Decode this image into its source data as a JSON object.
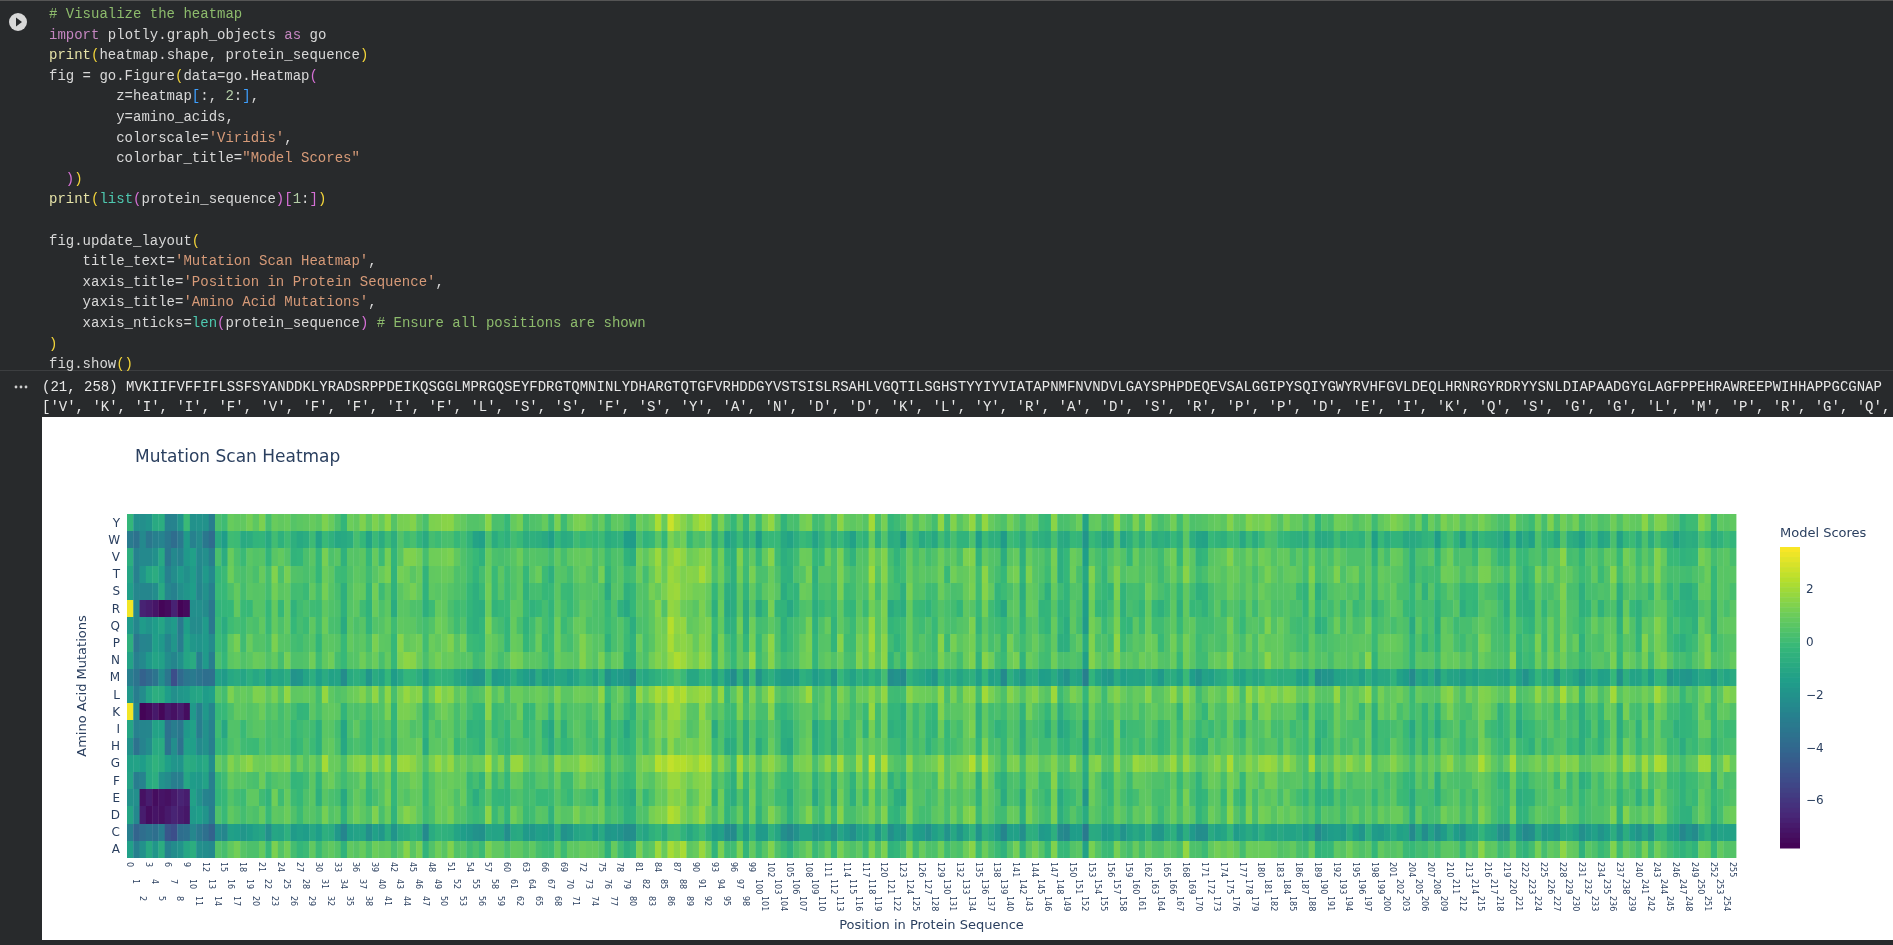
{
  "code_cell": {
    "lines": [
      {
        "tokens": [
          {
            "kind": "comment",
            "text": "# Visualize the heatmap"
          }
        ]
      },
      {
        "tokens": [
          {
            "kind": "keyword",
            "text": "import"
          },
          {
            "kind": "plain",
            "text": " plotly.graph_objects "
          },
          {
            "kind": "keyword",
            "text": "as"
          },
          {
            "kind": "plain",
            "text": " go"
          }
        ]
      },
      {
        "tokens": [
          {
            "kind": "func",
            "text": "print"
          },
          {
            "kind": "b1",
            "text": "("
          },
          {
            "kind": "plain",
            "text": "heatmap.shape, protein_sequence"
          },
          {
            "kind": "b1",
            "text": ")"
          }
        ]
      },
      {
        "tokens": [
          {
            "kind": "plain",
            "text": "fig = go.Figure"
          },
          {
            "kind": "b1",
            "text": "("
          },
          {
            "kind": "plain",
            "text": "data=go.Heatmap"
          },
          {
            "kind": "b2",
            "text": "("
          }
        ]
      },
      {
        "tokens": [
          {
            "kind": "plain",
            "text": "        z=heatmap"
          },
          {
            "kind": "b3",
            "text": "["
          },
          {
            "kind": "plain",
            "text": ":, "
          },
          {
            "kind": "number",
            "text": "2"
          },
          {
            "kind": "plain",
            "text": ":"
          },
          {
            "kind": "b3",
            "text": "]"
          },
          {
            "kind": "plain",
            "text": ","
          }
        ]
      },
      {
        "tokens": [
          {
            "kind": "plain",
            "text": "        y=amino_acids,"
          }
        ]
      },
      {
        "tokens": [
          {
            "kind": "plain",
            "text": "        colorscale="
          },
          {
            "kind": "string",
            "text": "'Viridis'"
          },
          {
            "kind": "plain",
            "text": ","
          }
        ]
      },
      {
        "tokens": [
          {
            "kind": "plain",
            "text": "        colorbar_title="
          },
          {
            "kind": "string",
            "text": "\"Model Scores\""
          }
        ]
      },
      {
        "tokens": [
          {
            "kind": "b2",
            "text": "  )"
          },
          {
            "kind": "b1",
            "text": ")"
          }
        ]
      },
      {
        "tokens": [
          {
            "kind": "func",
            "text": "print"
          },
          {
            "kind": "b1",
            "text": "("
          },
          {
            "kind": "builtin",
            "text": "list"
          },
          {
            "kind": "b2",
            "text": "("
          },
          {
            "kind": "plain",
            "text": "protein_sequence"
          },
          {
            "kind": "b2",
            "text": ")"
          },
          {
            "kind": "b2",
            "text": "["
          },
          {
            "kind": "number",
            "text": "1"
          },
          {
            "kind": "plain",
            "text": ":"
          },
          {
            "kind": "b2",
            "text": "]"
          },
          {
            "kind": "b1",
            "text": ")"
          }
        ]
      },
      {
        "gap_before": true,
        "tokens": [
          {
            "kind": "plain",
            "text": "fig.update_layout"
          },
          {
            "kind": "b1",
            "text": "("
          }
        ]
      },
      {
        "tokens": [
          {
            "kind": "plain",
            "text": "    title_text="
          },
          {
            "kind": "string",
            "text": "'Mutation Scan Heatmap'"
          },
          {
            "kind": "plain",
            "text": ","
          }
        ]
      },
      {
        "tokens": [
          {
            "kind": "plain",
            "text": "    xaxis_title="
          },
          {
            "kind": "string",
            "text": "'Position in Protein Sequence'"
          },
          {
            "kind": "plain",
            "text": ","
          }
        ]
      },
      {
        "tokens": [
          {
            "kind": "plain",
            "text": "    yaxis_title="
          },
          {
            "kind": "string",
            "text": "'Amino Acid Mutations'"
          },
          {
            "kind": "plain",
            "text": ","
          }
        ]
      },
      {
        "tokens": [
          {
            "kind": "plain",
            "text": "    xaxis_nticks="
          },
          {
            "kind": "builtin",
            "text": "len"
          },
          {
            "kind": "b2",
            "text": "("
          },
          {
            "kind": "plain",
            "text": "protein_sequence"
          },
          {
            "kind": "b2",
            "text": ")"
          },
          {
            "kind": "comment",
            "text": " # Ensure all positions are shown"
          }
        ]
      },
      {
        "tokens": [
          {
            "kind": "b1",
            "text": ")"
          }
        ]
      },
      {
        "tokens": [
          {
            "kind": "plain",
            "text": "fig.show"
          },
          {
            "kind": "b1",
            "text": "()"
          }
        ]
      }
    ]
  },
  "output": {
    "lines": [
      "(21, 258) MVKIIFVFFIFLSSFSYANDDKLYRADSRPPDEIKQSGGLMPRGQSEYFDRGTQMNINLYDHARGTQTGFVRHDDGYVSTSISLRSAHLVGQTILSGHSTYYIYVIATAPNMFNVNDVLGAYSPHPDEQEVSALGGIPYSQIYGWYRVHFGVLDEQLHRNRGYRDRYYSNLDIAPAADGYGLAGFPPEHRAWREEPWIHHAPPGCGNAP",
      "['V', 'K', 'I', 'I', 'F', 'V', 'F', 'F', 'I', 'F', 'L', 'S', 'S', 'F', 'S', 'Y', 'A', 'N', 'D', 'D', 'K', 'L', 'Y', 'R', 'A', 'D', 'S', 'R', 'P', 'P', 'D', 'E', 'I', 'K', 'Q', 'S', 'G', 'G', 'L', 'M', 'P', 'R', 'G', 'Q',"
    ]
  },
  "plot": {
    "title": "Mutation Scan Heatmap",
    "yaxis_title": "Amino Acid Mutations",
    "xaxis_title": "Position in Protein Sequence",
    "y_labels": [
      "Y",
      "W",
      "V",
      "T",
      "S",
      "R",
      "Q",
      "P",
      "N",
      "M",
      "L",
      "K",
      "I",
      "H",
      "G",
      "F",
      "E",
      "D",
      "C",
      "A"
    ],
    "x_ticks": [
      "0",
      "1",
      "2",
      "3",
      "4",
      "5",
      "6",
      "7",
      "8",
      "9",
      "10",
      "11",
      "12",
      "13",
      "14",
      "15",
      "16",
      "17",
      "18",
      "19",
      "20",
      "21",
      "22",
      "23",
      "24",
      "25",
      "26",
      "27",
      "28",
      "29",
      "30",
      "31",
      "32",
      "33",
      "34",
      "35",
      "36",
      "37",
      "38",
      "39",
      "40",
      "41",
      "42",
      "43",
      "44",
      "45",
      "46",
      "47",
      "48",
      "49",
      "50",
      "51",
      "52",
      "53",
      "54",
      "55",
      "56",
      "57",
      "58",
      "59",
      "60",
      "61",
      "62",
      "63",
      "64",
      "65",
      "66",
      "67",
      "68",
      "69",
      "70",
      "71",
      "72",
      "73",
      "74",
      "75",
      "76",
      "77",
      "78",
      "79",
      "80",
      "81",
      "82",
      "83",
      "84",
      "85",
      "86",
      "87",
      "88",
      "89",
      "90",
      "91",
      "92",
      "93",
      "94",
      "95",
      "96",
      "97",
      "98",
      "99",
      "100",
      "101",
      "102",
      "103",
      "104",
      "105",
      "106",
      "107",
      "108",
      "109",
      "110",
      "111",
      "112",
      "113",
      "114",
      "115",
      "116",
      "117",
      "118",
      "119",
      "120",
      "121",
      "122",
      "123",
      "124",
      "125",
      "126",
      "127",
      "128",
      "129",
      "130",
      "131",
      "132",
      "133",
      "134",
      "135",
      "136",
      "137",
      "138",
      "139",
      "140",
      "141",
      "142",
      "143",
      "144",
      "145",
      "146",
      "147",
      "148",
      "149",
      "150",
      "151",
      "152",
      "153",
      "154",
      "155",
      "156",
      "157",
      "158",
      "159",
      "160",
      "161",
      "162",
      "163",
      "164",
      "165",
      "166",
      "167",
      "168",
      "169",
      "170",
      "171",
      "172",
      "173",
      "174",
      "175",
      "176",
      "177",
      "178",
      "179",
      "180",
      "181",
      "182",
      "183",
      "184",
      "185",
      "186",
      "187",
      "188",
      "189",
      "190",
      "191",
      "192",
      "193",
      "194",
      "195",
      "196",
      "197",
      "198",
      "199",
      "200",
      "201",
      "202",
      "203",
      "204",
      "205",
      "206",
      "207",
      "208",
      "209",
      "210",
      "211",
      "212",
      "213",
      "214",
      "215",
      "216",
      "217",
      "218",
      "219",
      "220",
      "221",
      "222",
      "223",
      "224",
      "225",
      "226",
      "227",
      "228",
      "229",
      "230",
      "231",
      "232",
      "233",
      "234",
      "235",
      "236",
      "237",
      "238",
      "239",
      "240",
      "241",
      "242",
      "243",
      "244",
      "245",
      "246",
      "247",
      "248",
      "249",
      "250",
      "251",
      "252",
      "253",
      "254",
      "255"
    ],
    "colorbar": {
      "title": "Model Scores",
      "ticks": [
        "2",
        "0",
        "−2",
        "−4",
        "−6"
      ]
    }
  }
}
